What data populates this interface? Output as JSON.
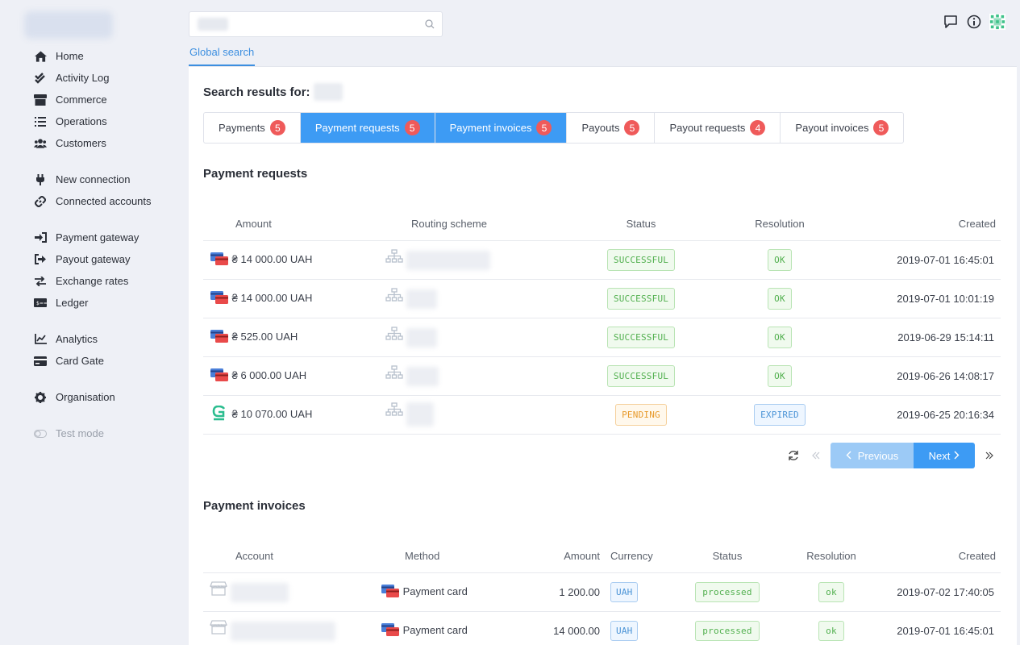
{
  "sidebar": {
    "groups": [
      [
        {
          "label": "Home",
          "icon": "home-icon"
        },
        {
          "label": "Activity Log",
          "icon": "double-check-icon"
        },
        {
          "label": "Commerce",
          "icon": "store-icon"
        },
        {
          "label": "Operations",
          "icon": "list-icon"
        },
        {
          "label": "Customers",
          "icon": "users-icon"
        }
      ],
      [
        {
          "label": "New connection",
          "icon": "plug-icon"
        },
        {
          "label": "Connected accounts",
          "icon": "link-icon"
        }
      ],
      [
        {
          "label": "Payment gateway",
          "icon": "sign-in-icon"
        },
        {
          "label": "Payout gateway",
          "icon": "sign-out-icon"
        },
        {
          "label": "Exchange rates",
          "icon": "exchange-icon"
        },
        {
          "label": "Ledger",
          "icon": "money-bill-icon"
        }
      ],
      [
        {
          "label": "Analytics",
          "icon": "chart-line-icon"
        },
        {
          "label": "Card Gate",
          "icon": "credit-card-icon"
        }
      ],
      [
        {
          "label": "Organisation",
          "icon": "gear-icon"
        }
      ],
      [
        {
          "label": "Test mode",
          "icon": "toggle-icon"
        }
      ]
    ]
  },
  "search": {
    "placeholder": "",
    "tab_label": "Global search"
  },
  "results": {
    "title": "Search results for:",
    "tabs": [
      {
        "label": "Payments",
        "count": "5",
        "active": false
      },
      {
        "label": "Payment requests",
        "count": "5",
        "active": true
      },
      {
        "label": "Payment invoices",
        "count": "5",
        "active": true
      },
      {
        "label": "Payouts",
        "count": "5",
        "active": false
      },
      {
        "label": "Payout requests",
        "count": "4",
        "active": false
      },
      {
        "label": "Payout invoices",
        "count": "5",
        "active": false
      }
    ]
  },
  "payment_requests": {
    "title": "Payment requests",
    "columns": [
      "Amount",
      "Routing scheme",
      "Status",
      "Resolution",
      "Created"
    ],
    "rows": [
      {
        "method": "card",
        "amount": "₴ 14 000.00 UAH",
        "status": "SUCCESSFUL",
        "resolution": "OK",
        "created": "2019-07-01 16:45:01"
      },
      {
        "method": "card",
        "amount": "₴ 14 000.00 UAH",
        "status": "SUCCESSFUL",
        "resolution": "OK",
        "created": "2019-07-01 10:01:19"
      },
      {
        "method": "card",
        "amount": "₴ 525.00 UAH",
        "status": "SUCCESSFUL",
        "resolution": "OK",
        "created": "2019-06-29 15:14:11"
      },
      {
        "method": "card",
        "amount": "₴ 6 000.00 UAH",
        "status": "SUCCESSFUL",
        "resolution": "OK",
        "created": "2019-06-26 14:08:17"
      },
      {
        "method": "gpay",
        "amount": "₴ 10 070.00 UAH",
        "status": "PENDING",
        "resolution": "EXPIRED",
        "created": "2019-06-25 20:16:34"
      }
    ],
    "pagination": {
      "prev": "Previous",
      "next": "Next"
    }
  },
  "payment_invoices": {
    "title": "Payment invoices",
    "columns": [
      "Account",
      "Method",
      "Amount",
      "Currency",
      "Status",
      "Resolution",
      "Created"
    ],
    "rows": [
      {
        "method": "Payment card",
        "amount": "1 200.00",
        "currency": "UAH",
        "status": "processed",
        "resolution": "ok",
        "created": "2019-07-02 17:40:05"
      },
      {
        "method": "Payment card",
        "amount": "14 000.00",
        "currency": "UAH",
        "status": "processed",
        "resolution": "ok",
        "created": "2019-07-01 16:45:01"
      }
    ]
  },
  "colors": {
    "accent": "#3d9bf4",
    "badge": "#ef5a5a",
    "success": "#52b04f",
    "pending": "#e79a2c"
  }
}
